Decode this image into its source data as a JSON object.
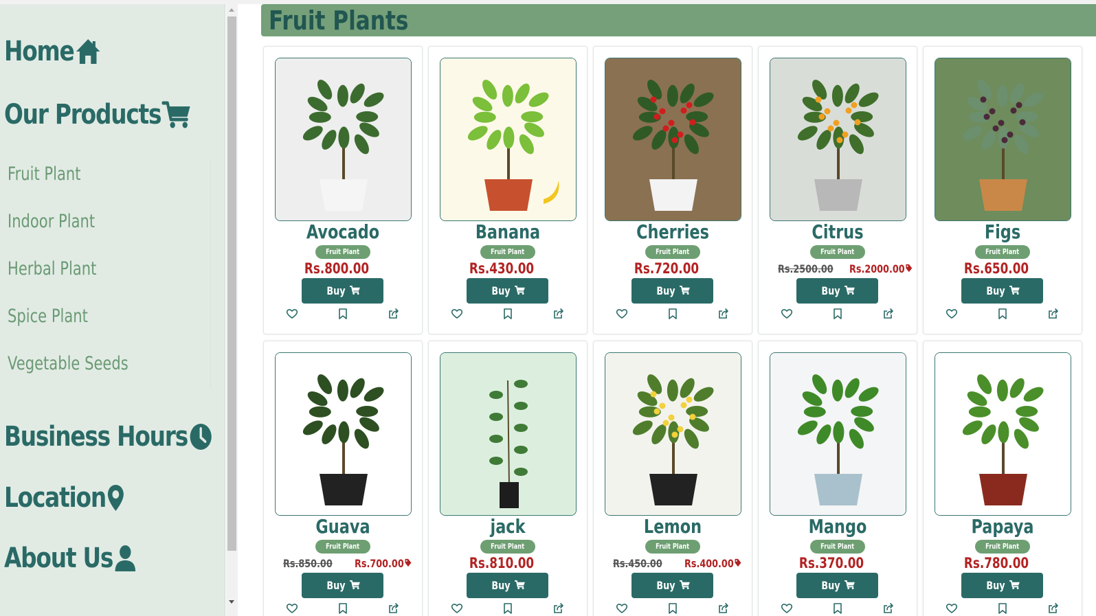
{
  "sidebar": {
    "home": "Home",
    "products": "Our Products",
    "categories": [
      "Fruit Plant",
      "Indoor Plant",
      "Herbal Plant",
      "Spice Plant",
      "Vegetable Seeds"
    ],
    "hours": "Business Hours",
    "location": "Location",
    "about": "About Us"
  },
  "header": {
    "title": "Fruit Plants"
  },
  "icons": [
    "home-icon",
    "cart-icon",
    "clock-icon",
    "location-pin-icon",
    "user-icon",
    "heart-icon",
    "bookmark-icon",
    "share-icon",
    "tag-icon"
  ],
  "colors": {
    "primary": "#2a6a66",
    "header": "#75a079",
    "sidebar": "#e1ebe4",
    "badge": "#6e9f72",
    "price": "#b22222"
  },
  "products": [
    {
      "name": "Avocado",
      "badge": "Fruit Plant",
      "price": "Rs.800.00",
      "old_price": "",
      "buy": "Buy"
    },
    {
      "name": "Banana",
      "badge": "Fruit Plant",
      "price": "Rs.430.00",
      "old_price": "",
      "buy": "Buy"
    },
    {
      "name": "Cherries",
      "badge": "Fruit Plant",
      "price": "Rs.720.00",
      "old_price": "",
      "buy": "Buy"
    },
    {
      "name": "Citrus",
      "badge": "Fruit Plant",
      "price": "Rs.2000.00",
      "old_price": "Rs.2500.00",
      "buy": "Buy"
    },
    {
      "name": "Figs",
      "badge": "Fruit Plant",
      "price": "Rs.650.00",
      "old_price": "",
      "buy": "Buy"
    },
    {
      "name": "Guava",
      "badge": "Fruit Plant",
      "price": "Rs.700.00",
      "old_price": "Rs.850.00",
      "buy": "Buy"
    },
    {
      "name": "jack",
      "badge": "Fruit Plant",
      "price": "Rs.810.00",
      "old_price": "",
      "buy": "Buy"
    },
    {
      "name": "Lemon",
      "badge": "Fruit Plant",
      "price": "Rs.400.00",
      "old_price": "Rs.450.00",
      "buy": "Buy"
    },
    {
      "name": "Mango",
      "badge": "Fruit Plant",
      "price": "Rs.370.00",
      "old_price": "",
      "buy": "Buy"
    },
    {
      "name": "Papaya",
      "badge": "Fruit Plant",
      "price": "Rs.780.00",
      "old_price": "",
      "buy": "Buy"
    }
  ]
}
